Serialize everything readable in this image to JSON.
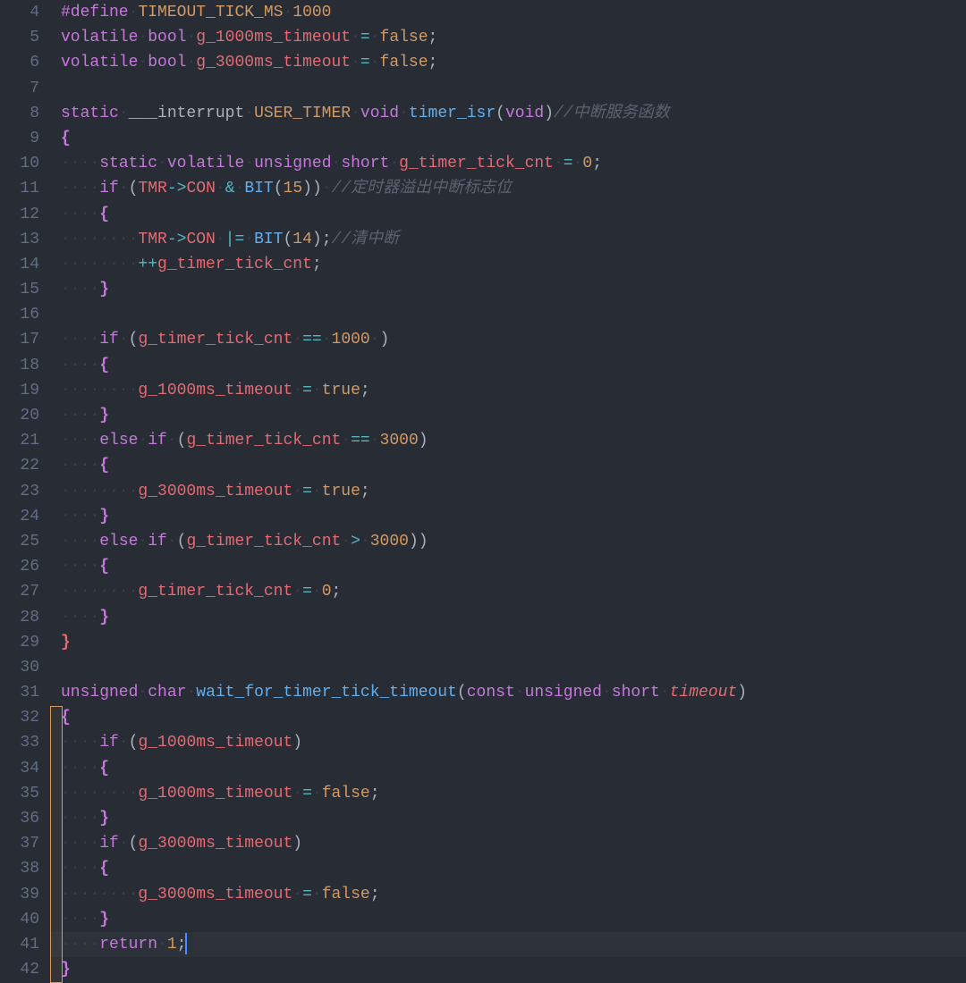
{
  "editor": {
    "startLine": 4,
    "endLine": 42,
    "currentLine": 41,
    "lines": {
      "4": [
        {
          "c": "pre",
          "t": "#define"
        },
        {
          "c": "ws",
          "t": "·"
        },
        {
          "c": "macro",
          "t": "TIMEOUT_TICK_MS"
        },
        {
          "c": "ws",
          "t": "·"
        },
        {
          "c": "num",
          "t": "1000"
        }
      ],
      "5": [
        {
          "c": "type",
          "t": "volatile"
        },
        {
          "c": "ws",
          "t": "·"
        },
        {
          "c": "type",
          "t": "bool"
        },
        {
          "c": "ws",
          "t": "·"
        },
        {
          "c": "var",
          "t": "g_1000ms_timeout"
        },
        {
          "c": "ws",
          "t": "·"
        },
        {
          "c": "op",
          "t": "="
        },
        {
          "c": "ws",
          "t": "·"
        },
        {
          "c": "bool",
          "t": "false"
        },
        {
          "c": "text",
          "t": ";"
        }
      ],
      "6": [
        {
          "c": "type",
          "t": "volatile"
        },
        {
          "c": "ws",
          "t": "·"
        },
        {
          "c": "type",
          "t": "bool"
        },
        {
          "c": "ws",
          "t": "·"
        },
        {
          "c": "var",
          "t": "g_3000ms_timeout"
        },
        {
          "c": "ws",
          "t": "·"
        },
        {
          "c": "op",
          "t": "="
        },
        {
          "c": "ws",
          "t": "·"
        },
        {
          "c": "bool",
          "t": "false"
        },
        {
          "c": "text",
          "t": ";"
        }
      ],
      "7": [],
      "8": [
        {
          "c": "kw",
          "t": "static"
        },
        {
          "c": "ws",
          "t": "·"
        },
        {
          "c": "text",
          "t": "___interrupt"
        },
        {
          "c": "ws",
          "t": "·"
        },
        {
          "c": "macro",
          "t": "USER_TIMER"
        },
        {
          "c": "ws",
          "t": "·"
        },
        {
          "c": "type",
          "t": "void"
        },
        {
          "c": "ws",
          "t": "·"
        },
        {
          "c": "fn",
          "t": "timer_isr"
        },
        {
          "c": "paren",
          "t": "("
        },
        {
          "c": "type",
          "t": "void"
        },
        {
          "c": "paren",
          "t": ")"
        },
        {
          "c": "comment",
          "t": "//中断服务函数"
        }
      ],
      "9": [
        {
          "c": "brace",
          "t": "{"
        }
      ],
      "10": [
        {
          "c": "ws",
          "t": "····"
        },
        {
          "c": "kw",
          "t": "static"
        },
        {
          "c": "ws",
          "t": "·"
        },
        {
          "c": "type",
          "t": "volatile"
        },
        {
          "c": "ws",
          "t": "·"
        },
        {
          "c": "type",
          "t": "unsigned"
        },
        {
          "c": "ws",
          "t": "·"
        },
        {
          "c": "type",
          "t": "short"
        },
        {
          "c": "ws",
          "t": "·"
        },
        {
          "c": "var",
          "t": "g_timer_tick_cnt"
        },
        {
          "c": "ws",
          "t": "·"
        },
        {
          "c": "op",
          "t": "="
        },
        {
          "c": "ws",
          "t": "·"
        },
        {
          "c": "num",
          "t": "0"
        },
        {
          "c": "text",
          "t": ";"
        }
      ],
      "11": [
        {
          "c": "ws",
          "t": "····"
        },
        {
          "c": "kw",
          "t": "if"
        },
        {
          "c": "ws",
          "t": "·"
        },
        {
          "c": "paren",
          "t": "("
        },
        {
          "c": "var",
          "t": "TMR"
        },
        {
          "c": "op",
          "t": "->"
        },
        {
          "c": "var",
          "t": "CON"
        },
        {
          "c": "ws",
          "t": "·"
        },
        {
          "c": "op",
          "t": "&"
        },
        {
          "c": "ws",
          "t": "·"
        },
        {
          "c": "fn",
          "t": "BIT"
        },
        {
          "c": "paren",
          "t": "("
        },
        {
          "c": "num",
          "t": "15"
        },
        {
          "c": "paren",
          "t": ")"
        },
        {
          "c": "paren",
          "t": ")"
        },
        {
          "c": "ws",
          "t": "·"
        },
        {
          "c": "comment",
          "t": "//定时器溢出中断标志位"
        }
      ],
      "12": [
        {
          "c": "ws",
          "t": "····"
        },
        {
          "c": "brace",
          "t": "{"
        }
      ],
      "13": [
        {
          "c": "ws",
          "t": "········"
        },
        {
          "c": "var",
          "t": "TMR"
        },
        {
          "c": "op",
          "t": "->"
        },
        {
          "c": "var",
          "t": "CON"
        },
        {
          "c": "ws",
          "t": "·"
        },
        {
          "c": "op",
          "t": "|="
        },
        {
          "c": "ws",
          "t": "·"
        },
        {
          "c": "fn",
          "t": "BIT"
        },
        {
          "c": "paren",
          "t": "("
        },
        {
          "c": "num",
          "t": "14"
        },
        {
          "c": "paren",
          "t": ")"
        },
        {
          "c": "text",
          "t": ";"
        },
        {
          "c": "comment",
          "t": "//清中断"
        }
      ],
      "14": [
        {
          "c": "ws",
          "t": "········"
        },
        {
          "c": "op",
          "t": "++"
        },
        {
          "c": "var",
          "t": "g_timer_tick_cnt"
        },
        {
          "c": "text",
          "t": ";"
        }
      ],
      "15": [
        {
          "c": "ws",
          "t": "····"
        },
        {
          "c": "brace",
          "t": "}"
        }
      ],
      "16": [],
      "17": [
        {
          "c": "ws",
          "t": "····"
        },
        {
          "c": "kw",
          "t": "if"
        },
        {
          "c": "ws",
          "t": "·"
        },
        {
          "c": "paren",
          "t": "("
        },
        {
          "c": "var",
          "t": "g_timer_tick_cnt"
        },
        {
          "c": "ws",
          "t": "·"
        },
        {
          "c": "op",
          "t": "=="
        },
        {
          "c": "ws",
          "t": "·"
        },
        {
          "c": "num",
          "t": "1000"
        },
        {
          "c": "ws",
          "t": "·"
        },
        {
          "c": "paren",
          "t": ")"
        }
      ],
      "18": [
        {
          "c": "ws",
          "t": "····"
        },
        {
          "c": "brace",
          "t": "{"
        }
      ],
      "19": [
        {
          "c": "ws",
          "t": "········"
        },
        {
          "c": "var",
          "t": "g_1000ms_timeout"
        },
        {
          "c": "ws",
          "t": "·"
        },
        {
          "c": "op",
          "t": "="
        },
        {
          "c": "ws",
          "t": "·"
        },
        {
          "c": "bool",
          "t": "true"
        },
        {
          "c": "text",
          "t": ";"
        }
      ],
      "20": [
        {
          "c": "ws",
          "t": "····"
        },
        {
          "c": "brace",
          "t": "}"
        }
      ],
      "21": [
        {
          "c": "ws",
          "t": "····"
        },
        {
          "c": "kw",
          "t": "else"
        },
        {
          "c": "ws",
          "t": "·"
        },
        {
          "c": "kw",
          "t": "if"
        },
        {
          "c": "ws",
          "t": "·"
        },
        {
          "c": "paren",
          "t": "("
        },
        {
          "c": "var",
          "t": "g_timer_tick_cnt"
        },
        {
          "c": "ws",
          "t": "·"
        },
        {
          "c": "op",
          "t": "=="
        },
        {
          "c": "ws",
          "t": "·"
        },
        {
          "c": "num",
          "t": "3000"
        },
        {
          "c": "paren",
          "t": ")"
        }
      ],
      "22": [
        {
          "c": "ws",
          "t": "····"
        },
        {
          "c": "brace",
          "t": "{"
        }
      ],
      "23": [
        {
          "c": "ws",
          "t": "········"
        },
        {
          "c": "var",
          "t": "g_3000ms_timeout"
        },
        {
          "c": "ws",
          "t": "·"
        },
        {
          "c": "op",
          "t": "="
        },
        {
          "c": "ws",
          "t": "·"
        },
        {
          "c": "bool",
          "t": "true"
        },
        {
          "c": "text",
          "t": ";"
        }
      ],
      "24": [
        {
          "c": "ws",
          "t": "····"
        },
        {
          "c": "brace",
          "t": "}"
        }
      ],
      "25": [
        {
          "c": "ws",
          "t": "····"
        },
        {
          "c": "kw",
          "t": "else"
        },
        {
          "c": "ws",
          "t": "·"
        },
        {
          "c": "kw",
          "t": "if"
        },
        {
          "c": "ws",
          "t": "·"
        },
        {
          "c": "paren",
          "t": "("
        },
        {
          "c": "var",
          "t": "g_timer_tick_cnt"
        },
        {
          "c": "ws",
          "t": "·"
        },
        {
          "c": "op",
          "t": ">"
        },
        {
          "c": "ws",
          "t": "·"
        },
        {
          "c": "num",
          "t": "3000"
        },
        {
          "c": "paren",
          "t": ")"
        },
        {
          "c": "paren",
          "t": ")"
        }
      ],
      "26": [
        {
          "c": "ws",
          "t": "····"
        },
        {
          "c": "brace",
          "t": "{"
        }
      ],
      "27": [
        {
          "c": "ws",
          "t": "········"
        },
        {
          "c": "var",
          "t": "g_timer_tick_cnt"
        },
        {
          "c": "ws",
          "t": "·"
        },
        {
          "c": "op",
          "t": "="
        },
        {
          "c": "ws",
          "t": "·"
        },
        {
          "c": "num",
          "t": "0"
        },
        {
          "c": "text",
          "t": ";"
        }
      ],
      "28": [
        {
          "c": "ws",
          "t": "····"
        },
        {
          "c": "brace",
          "t": "}"
        }
      ],
      "29": [
        {
          "c": "brace2",
          "t": "}"
        }
      ],
      "30": [],
      "31": [
        {
          "c": "type",
          "t": "unsigned"
        },
        {
          "c": "ws",
          "t": "·"
        },
        {
          "c": "type",
          "t": "char"
        },
        {
          "c": "ws",
          "t": "·"
        },
        {
          "c": "fn",
          "t": "wait_for_timer_tick_timeout"
        },
        {
          "c": "paren",
          "t": "("
        },
        {
          "c": "kw",
          "t": "const"
        },
        {
          "c": "ws",
          "t": "·"
        },
        {
          "c": "type",
          "t": "unsigned"
        },
        {
          "c": "ws",
          "t": "·"
        },
        {
          "c": "type",
          "t": "short"
        },
        {
          "c": "ws",
          "t": "·"
        },
        {
          "c": "param",
          "t": "timeout"
        },
        {
          "c": "paren",
          "t": ")"
        }
      ],
      "32": [
        {
          "c": "brace",
          "t": "{"
        }
      ],
      "33": [
        {
          "c": "ws",
          "t": "····"
        },
        {
          "c": "kw",
          "t": "if"
        },
        {
          "c": "ws",
          "t": "·"
        },
        {
          "c": "paren",
          "t": "("
        },
        {
          "c": "var",
          "t": "g_1000ms_timeout"
        },
        {
          "c": "paren",
          "t": ")"
        }
      ],
      "34": [
        {
          "c": "ws",
          "t": "····"
        },
        {
          "c": "brace",
          "t": "{"
        }
      ],
      "35": [
        {
          "c": "ws",
          "t": "········"
        },
        {
          "c": "var",
          "t": "g_1000ms_timeout"
        },
        {
          "c": "ws",
          "t": "·"
        },
        {
          "c": "op",
          "t": "="
        },
        {
          "c": "ws",
          "t": "·"
        },
        {
          "c": "bool",
          "t": "false"
        },
        {
          "c": "text",
          "t": ";"
        }
      ],
      "36": [
        {
          "c": "ws",
          "t": "····"
        },
        {
          "c": "brace",
          "t": "}"
        }
      ],
      "37": [
        {
          "c": "ws",
          "t": "····"
        },
        {
          "c": "kw",
          "t": "if"
        },
        {
          "c": "ws",
          "t": "·"
        },
        {
          "c": "paren",
          "t": "("
        },
        {
          "c": "var",
          "t": "g_3000ms_timeout"
        },
        {
          "c": "paren",
          "t": ")"
        }
      ],
      "38": [
        {
          "c": "ws",
          "t": "····"
        },
        {
          "c": "brace",
          "t": "{"
        }
      ],
      "39": [
        {
          "c": "ws",
          "t": "········"
        },
        {
          "c": "var",
          "t": "g_3000ms_timeout"
        },
        {
          "c": "ws",
          "t": "·"
        },
        {
          "c": "op",
          "t": "="
        },
        {
          "c": "ws",
          "t": "·"
        },
        {
          "c": "bool",
          "t": "false"
        },
        {
          "c": "text",
          "t": ";"
        }
      ],
      "40": [
        {
          "c": "ws",
          "t": "····"
        },
        {
          "c": "brace",
          "t": "}"
        }
      ],
      "41": [
        {
          "c": "ws",
          "t": "····"
        },
        {
          "c": "kw",
          "t": "return"
        },
        {
          "c": "ws",
          "t": "·"
        },
        {
          "c": "num",
          "t": "1"
        },
        {
          "c": "text",
          "t": ";"
        }
      ],
      "42": [
        {
          "c": "brace",
          "t": "}"
        }
      ]
    },
    "selectionBox": {
      "topLine": 32,
      "bottomLine": 42,
      "left": 0,
      "width": 14
    }
  }
}
